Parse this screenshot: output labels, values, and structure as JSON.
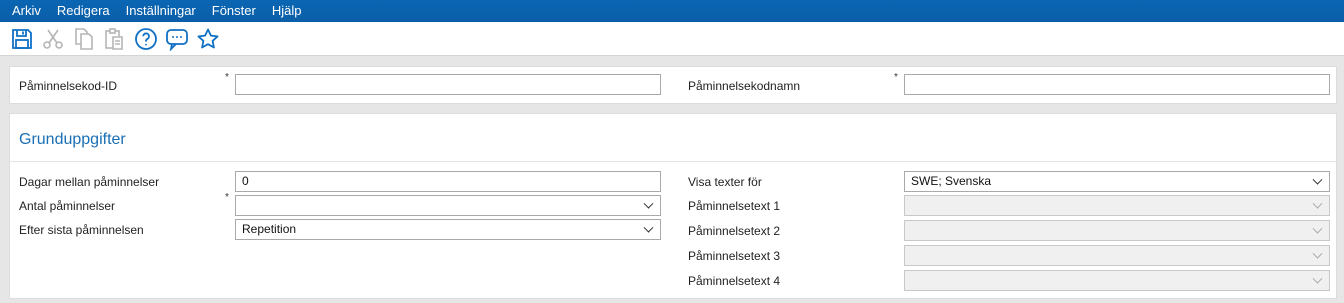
{
  "menu": [
    "Arkiv",
    "Redigera",
    "Inställningar",
    "Fönster",
    "Hjälp"
  ],
  "toolbar": [
    {
      "name": "save-icon",
      "enabled": true
    },
    {
      "name": "cut-icon",
      "enabled": false
    },
    {
      "name": "copy-icon",
      "enabled": false
    },
    {
      "name": "paste-icon",
      "enabled": false
    },
    {
      "name": "help-icon",
      "enabled": true
    },
    {
      "name": "chat-icon",
      "enabled": true
    },
    {
      "name": "favorite-icon",
      "enabled": true
    }
  ],
  "colors": {
    "menubar": "#0b5ea8",
    "accent": "#1a6fb5",
    "icon": "#1170c4",
    "disabled_icon": "#b5b5b5"
  },
  "header": {
    "id_label": "Påminnelsekod-ID",
    "id_value": "",
    "name_label": "Påminnelsekodnamn",
    "name_value": "",
    "required_mark": "*"
  },
  "section": {
    "title": "Grunduppgifter",
    "days_label": "Dagar mellan påminnelser",
    "days_value": "0",
    "count_label": "Antal påminnelser",
    "count_value": "",
    "after_label": "Efter sista påminnelsen",
    "after_value": "Repetition",
    "show_texts_label": "Visa texter för",
    "show_texts_value": "SWE; Svenska",
    "text1_label": "Påminnelsetext 1",
    "text1_value": "",
    "text2_label": "Påminnelsetext 2",
    "text2_value": "",
    "text3_label": "Påminnelsetext 3",
    "text3_value": "",
    "text4_label": "Påminnelsetext 4",
    "text4_value": ""
  }
}
